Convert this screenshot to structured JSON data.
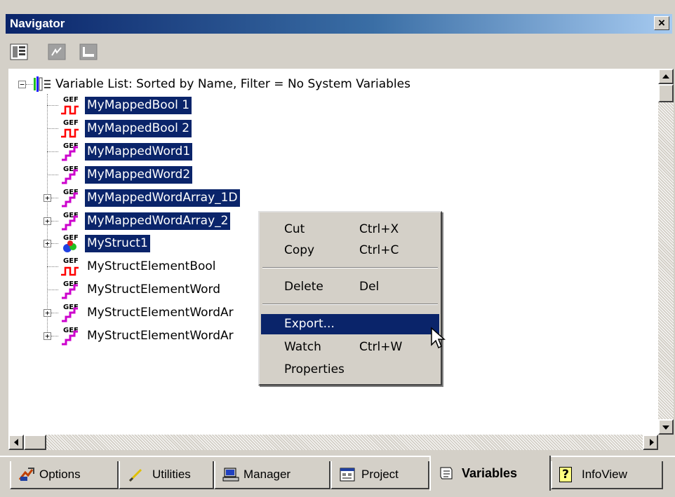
{
  "window": {
    "title": "Navigator",
    "close_glyph": "×"
  },
  "toolbar": {
    "icons": [
      "tree-view-icon",
      "variable-view-icon",
      "list-view-icon"
    ]
  },
  "tree": {
    "root_label": "Variable List: Sorted by Name, Filter = No System Variables",
    "root_icon": "variable-list-icon",
    "items": [
      {
        "label": "MyMappedBool 1",
        "type": "bool",
        "selected": true,
        "expandable": false
      },
      {
        "label": "MyMappedBool 2",
        "type": "bool",
        "selected": true,
        "expandable": false
      },
      {
        "label": "MyMappedWord1",
        "type": "word",
        "selected": true,
        "expandable": false
      },
      {
        "label": "MyMappedWord2",
        "type": "word",
        "selected": true,
        "expandable": false
      },
      {
        "label": "MyMappedWordArray_1D",
        "type": "word",
        "selected": true,
        "expandable": true
      },
      {
        "label": "MyMappedWordArray_2",
        "type": "word",
        "selected": true,
        "expandable": true
      },
      {
        "label": "MyStruct1",
        "type": "struct",
        "selected": true,
        "expandable": true
      },
      {
        "label": "MyStructElementBool",
        "type": "bool",
        "selected": false,
        "expandable": false
      },
      {
        "label": "MyStructElementWord",
        "type": "word",
        "selected": false,
        "expandable": false
      },
      {
        "label": "MyStructElementWordAr",
        "type": "word",
        "selected": false,
        "expandable": true
      },
      {
        "label": "MyStructElementWordAr",
        "type": "word",
        "selected": false,
        "expandable": true
      }
    ],
    "gef_text": "GEF"
  },
  "context_menu": {
    "items": [
      {
        "label": "Cut",
        "shortcut": "Ctrl+X"
      },
      {
        "label": "Copy",
        "shortcut": "Ctrl+C"
      },
      {
        "label": "Delete",
        "shortcut": "Del"
      },
      {
        "label": "Export...",
        "shortcut": "",
        "highlighted": true
      },
      {
        "label": "Watch",
        "shortcut": "Ctrl+W"
      },
      {
        "label": "Properties",
        "shortcut": ""
      }
    ]
  },
  "tabs": [
    {
      "label": "Options",
      "icon": "options-icon"
    },
    {
      "label": "Utilities",
      "icon": "utilities-icon"
    },
    {
      "label": "Manager",
      "icon": "manager-icon"
    },
    {
      "label": "Project",
      "icon": "project-icon"
    },
    {
      "label": "Variables",
      "icon": "variables-icon",
      "active": true
    },
    {
      "label": "InfoView",
      "icon": "infoview-icon"
    }
  ],
  "colors": {
    "selection": "#0a246a",
    "bool_icon": "#ff0000",
    "word_icon": "#cc00cc",
    "face": "#d4d0c8"
  }
}
